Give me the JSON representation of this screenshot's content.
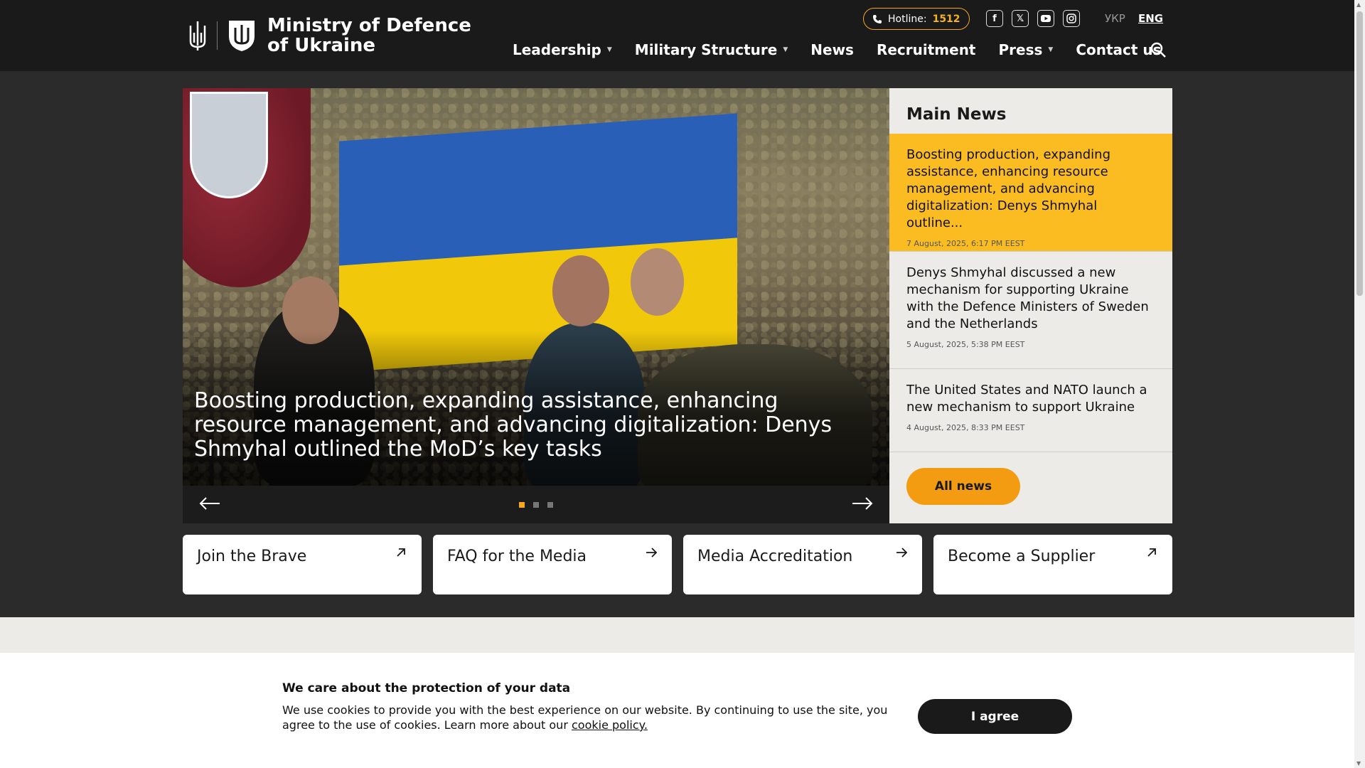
{
  "header": {
    "title_line1": "Ministry of Defence",
    "title_line2": "of Ukraine",
    "hotline_label": "Hotline:",
    "hotline_number": "1512",
    "lang_ukr": "УКР",
    "lang_eng": "ENG",
    "socials": [
      "facebook-icon",
      "x-twitter-icon",
      "youtube-icon",
      "instagram-icon"
    ]
  },
  "nav": {
    "items": [
      {
        "label": "Leadership",
        "has_dropdown": true
      },
      {
        "label": "Military Structure",
        "has_dropdown": true
      },
      {
        "label": "News",
        "has_dropdown": false
      },
      {
        "label": "Recruitment",
        "has_dropdown": false
      },
      {
        "label": "Press",
        "has_dropdown": true
      },
      {
        "label": "Contact us",
        "has_dropdown": false
      }
    ]
  },
  "hero": {
    "caption": "Boosting production, expanding assistance, enhancing resource management, and advancing digitalization: Denys Shmyhal outlined the MoD’s key tasks",
    "slides_count": 3,
    "active_slide": 1
  },
  "main_news": {
    "title": "Main News",
    "items": [
      {
        "text": "Boosting production, expanding assistance, enhancing resource management, and advancing digitalization: Denys Shmyhal outline...",
        "date": "7 August, 2025, 6:17 PM EEST"
      },
      {
        "text": "Denys Shmyhal discussed a new mechanism for supporting Ukraine with the Defence Ministers of Sweden and the Netherlands",
        "date": "5 August, 2025, 5:38 PM EEST"
      },
      {
        "text": "The United States and NATO launch a new mechanism to support Ukraine",
        "date": "4 August, 2025, 8:33 PM EEST"
      }
    ],
    "all_news_label": "All news"
  },
  "cards": [
    {
      "label": "Join the Brave",
      "icon": "external-link-icon"
    },
    {
      "label": "FAQ for the Media",
      "icon": "arrow-right-icon"
    },
    {
      "label": "Media Accreditation",
      "icon": "arrow-right-icon"
    },
    {
      "label": "Become a Supplier",
      "icon": "external-link-icon"
    }
  ],
  "cookie": {
    "title": "We care about the protection of your data",
    "text": "We use cookies to provide you with the best experience on our website. By continuing to use the site, you agree to the use of cookies. Learn more about our ",
    "link": "cookie policy.",
    "agree_label": "I agree"
  },
  "colors": {
    "accent": "#fbbc21",
    "button_orange": "#f39c12",
    "header_bg": "#1a1a1a"
  }
}
